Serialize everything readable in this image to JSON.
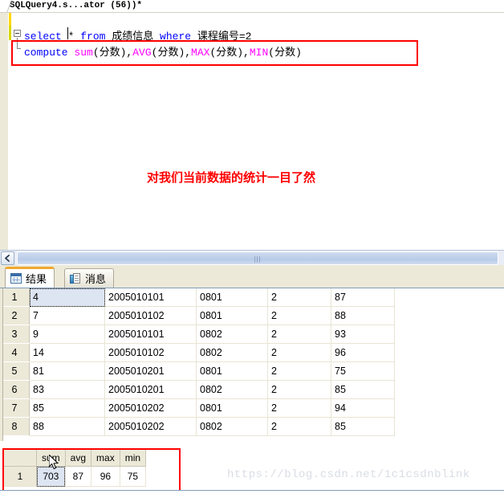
{
  "window": {
    "document_tab": "SQLQuery4.s...ator (56))*"
  },
  "editor": {
    "line1": {
      "kw_select": "select",
      "star": " * ",
      "kw_from": "from",
      "table": " 成绩信息 ",
      "kw_where": "where",
      "column": " 课程编号",
      "op_value": "=2"
    },
    "line2": {
      "kw_compute": "compute",
      "fn_sum": "sum",
      "arg_sum": "(分数),",
      "fn_avg": "AVG",
      "arg_avg": "(分数),",
      "fn_max": "MAX",
      "arg_max": "(分数),",
      "fn_min": "MIN",
      "arg_min": "(分数)"
    },
    "annotation": "对我们当前数据的统计一目了然",
    "highlight_color": "#ff0000"
  },
  "scrollbar": {
    "left_arrow": "scroll-left-icon"
  },
  "result_tabs": [
    {
      "label": "结果",
      "icon": "grid-icon",
      "active": true
    },
    {
      "label": "消息",
      "icon": "messages-icon",
      "active": false
    }
  ],
  "results_grid": {
    "rows": [
      {
        "n": "1",
        "id": "4",
        "sno": "2005010101",
        "cno": "0801",
        "term": "2",
        "score": "87"
      },
      {
        "n": "2",
        "id": "7",
        "sno": "2005010102",
        "cno": "0801",
        "term": "2",
        "score": "88"
      },
      {
        "n": "3",
        "id": "9",
        "sno": "2005010101",
        "cno": "0802",
        "term": "2",
        "score": "93"
      },
      {
        "n": "4",
        "id": "14",
        "sno": "2005010102",
        "cno": "0802",
        "term": "2",
        "score": "96"
      },
      {
        "n": "5",
        "id": "81",
        "sno": "2005010201",
        "cno": "0801",
        "term": "2",
        "score": "75"
      },
      {
        "n": "6",
        "id": "83",
        "sno": "2005010201",
        "cno": "0802",
        "term": "2",
        "score": "85"
      },
      {
        "n": "7",
        "id": "85",
        "sno": "2005010202",
        "cno": "0801",
        "term": "2",
        "score": "94"
      },
      {
        "n": "8",
        "id": "88",
        "sno": "2005010202",
        "cno": "0802",
        "term": "2",
        "score": "85"
      }
    ]
  },
  "summary_grid": {
    "headers": {
      "sum": "sum",
      "avg": "avg",
      "max": "max",
      "min": "min"
    },
    "row": {
      "n": "1",
      "sum": "703",
      "avg": "87",
      "max": "96",
      "min": "75"
    }
  },
  "watermark": "https://blog.csdn.net/1c1csdnblink"
}
